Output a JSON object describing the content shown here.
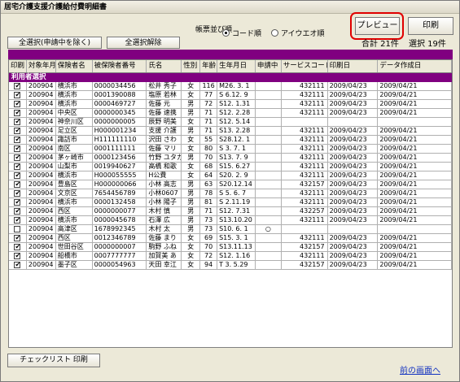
{
  "window": {
    "title": "居宅介護支援介護給付費明細書"
  },
  "toolbar": {
    "select_all_label": "全選択(申請中を除く)",
    "deselect_all_label": "全選択解除",
    "sort_label": "帳票並び順",
    "sort_options": [
      "コード順",
      "アイウエオ順"
    ],
    "preview_label": "プレビュー",
    "print_label": "印刷",
    "total_text": "合計 21件",
    "selected_text": "選択 19件"
  },
  "table": {
    "columns": [
      "印刷",
      "対象年月",
      "保険者名",
      "被保険者番号",
      "氏名",
      "性別",
      "年齢",
      "生年月日",
      "申請中",
      "サービスコード",
      "印刷日",
      "データ作成日"
    ],
    "section_label": "利用者選択",
    "rows": [
      {
        "checked": "✔",
        "ym": "200904",
        "insurer": "横浜市",
        "no": "0000034456",
        "name": "松井 秀子",
        "sex": "女",
        "age": "116",
        "birth": "M26. 3. 1",
        "pending": "",
        "code": "432111",
        "printed": "2009/04/23",
        "created": "2009/04/21"
      },
      {
        "checked": "✔",
        "ym": "200904",
        "insurer": "横浜市",
        "no": "0001390088",
        "name": "塩原 若林",
        "sex": "女",
        "age": "77",
        "birth": "S 6.12. 9",
        "pending": "",
        "code": "432111",
        "printed": "2009/04/23",
        "created": "2009/04/21"
      },
      {
        "checked": "✔",
        "ym": "200904",
        "insurer": "横浜市",
        "no": "0000469727",
        "name": "佐藤 元",
        "sex": "男",
        "age": "72",
        "birth": "S12. 1.31",
        "pending": "",
        "code": "432111",
        "printed": "2009/04/23",
        "created": "2009/04/21"
      },
      {
        "checked": "✔",
        "ym": "200904",
        "insurer": "中央区",
        "no": "0000000345",
        "name": "佐藤 速携",
        "sex": "男",
        "age": "71",
        "birth": "S12. 2.28",
        "pending": "",
        "code": "432111",
        "printed": "2009/04/23",
        "created": "2009/04/21"
      },
      {
        "checked": "✔",
        "ym": "200904",
        "insurer": "神奈川区",
        "no": "0000000005",
        "name": "辰野 明美",
        "sex": "女",
        "age": "71",
        "birth": "S12. 5.14",
        "pending": "",
        "code": "",
        "printed": "",
        "created": ""
      },
      {
        "checked": "✔",
        "ym": "200904",
        "insurer": "足立区",
        "no": "H000001234",
        "name": "支援 介護",
        "sex": "男",
        "age": "71",
        "birth": "S13. 2.28",
        "pending": "",
        "code": "432111",
        "printed": "2009/04/23",
        "created": "2009/04/21"
      },
      {
        "checked": "✔",
        "ym": "200904",
        "insurer": "諏訪市",
        "no": "H111111110",
        "name": "沢田 さわ",
        "sex": "女",
        "age": "55",
        "birth": "S28.12. 1",
        "pending": "",
        "code": "432111",
        "printed": "2009/04/23",
        "created": "2009/04/21"
      },
      {
        "checked": "✔",
        "ym": "200904",
        "insurer": "南区",
        "no": "0001111111",
        "name": "佐藤 マリ",
        "sex": "女",
        "age": "80",
        "birth": "S 3. 7. 1",
        "pending": "",
        "code": "432111",
        "printed": "2009/04/23",
        "created": "2009/04/21"
      },
      {
        "checked": "✔",
        "ym": "200904",
        "insurer": "茅ヶ崎市",
        "no": "0000123456",
        "name": "竹野 ユタカ",
        "sex": "男",
        "age": "70",
        "birth": "S13. 7. 9",
        "pending": "",
        "code": "432111",
        "printed": "2009/04/23",
        "created": "2009/04/21"
      },
      {
        "checked": "✔",
        "ym": "200904",
        "insurer": "山梨市",
        "no": "0019940627",
        "name": "高橋 和歌",
        "sex": "女",
        "age": "68",
        "birth": "S15. 6.27",
        "pending": "",
        "code": "432111",
        "printed": "2009/04/23",
        "created": "2009/04/21"
      },
      {
        "checked": "✔",
        "ym": "200904",
        "insurer": "横浜市",
        "no": "H000055555",
        "name": "H公費",
        "sex": "女",
        "age": "64",
        "birth": "S20. 2. 9",
        "pending": "",
        "code": "432111",
        "printed": "2009/04/23",
        "created": "2009/04/21"
      },
      {
        "checked": "✔",
        "ym": "200904",
        "insurer": "豊島区",
        "no": "H000000066",
        "name": "小林 高志",
        "sex": "男",
        "age": "63",
        "birth": "S20.12.14",
        "pending": "",
        "code": "432157",
        "printed": "2009/04/23",
        "created": "2009/04/21"
      },
      {
        "checked": "✔",
        "ym": "200904",
        "insurer": "文京区",
        "no": "7654456789",
        "name": "小林0607",
        "sex": "男",
        "age": "78",
        "birth": "S 5. 6. 7",
        "pending": "",
        "code": "432111",
        "printed": "2009/04/23",
        "created": "2009/04/21"
      },
      {
        "checked": "✔",
        "ym": "200904",
        "insurer": "横浜市",
        "no": "0000132458",
        "name": "小林 陽子",
        "sex": "男",
        "age": "81",
        "birth": "S 2.11.19",
        "pending": "",
        "code": "432111",
        "printed": "2009/04/23",
        "created": "2009/04/21"
      },
      {
        "checked": "✔",
        "ym": "200904",
        "insurer": "西区",
        "no": "0000000077",
        "name": "木村 慎",
        "sex": "男",
        "age": "71",
        "birth": "S12. 7.31",
        "pending": "",
        "code": "432257",
        "printed": "2009/04/23",
        "created": "2009/04/21"
      },
      {
        "checked": "✔",
        "ym": "200904",
        "insurer": "横浜市",
        "no": "0000045678",
        "name": "石澤 広",
        "sex": "男",
        "age": "73",
        "birth": "S13.10.20",
        "pending": "",
        "code": "432111",
        "printed": "2009/04/23",
        "created": "2009/04/21"
      },
      {
        "checked": "",
        "ym": "200904",
        "insurer": "高津区",
        "no": "1678992345",
        "name": "木村 太",
        "sex": "男",
        "age": "73",
        "birth": "S10. 6. 1",
        "pending": "○",
        "code": "",
        "printed": "",
        "created": ""
      },
      {
        "checked": "✔",
        "ym": "200904",
        "insurer": "西区",
        "no": "0012346789",
        "name": "佐藤 まり",
        "sex": "女",
        "age": "69",
        "birth": "S15. 3. 1",
        "pending": "",
        "code": "432111",
        "printed": "2009/04/23",
        "created": "2009/04/21"
      },
      {
        "checked": "✔",
        "ym": "200904",
        "insurer": "世田谷区",
        "no": "0000000007",
        "name": "駒野 ふね",
        "sex": "女",
        "age": "70",
        "birth": "S13.11.13",
        "pending": "",
        "code": "432157",
        "printed": "2009/04/23",
        "created": "2009/04/21"
      },
      {
        "checked": "✔",
        "ym": "200904",
        "insurer": "船橋市",
        "no": "0007777777",
        "name": "加賀美 あ",
        "sex": "女",
        "age": "72",
        "birth": "S12. 1.16",
        "pending": "",
        "code": "432111",
        "printed": "2009/04/23",
        "created": "2009/04/21"
      },
      {
        "checked": "✔",
        "ym": "200904",
        "insurer": "墨子区",
        "no": "0000054963",
        "name": "天田 幸江",
        "sex": "女",
        "age": "94",
        "birth": "T 3. 5.29",
        "pending": "",
        "code": "432157",
        "printed": "2009/04/23",
        "created": "2009/04/21"
      }
    ]
  },
  "footer": {
    "checklist_print_label": "チェックリスト 印刷",
    "back_link": "前の画面へ"
  }
}
